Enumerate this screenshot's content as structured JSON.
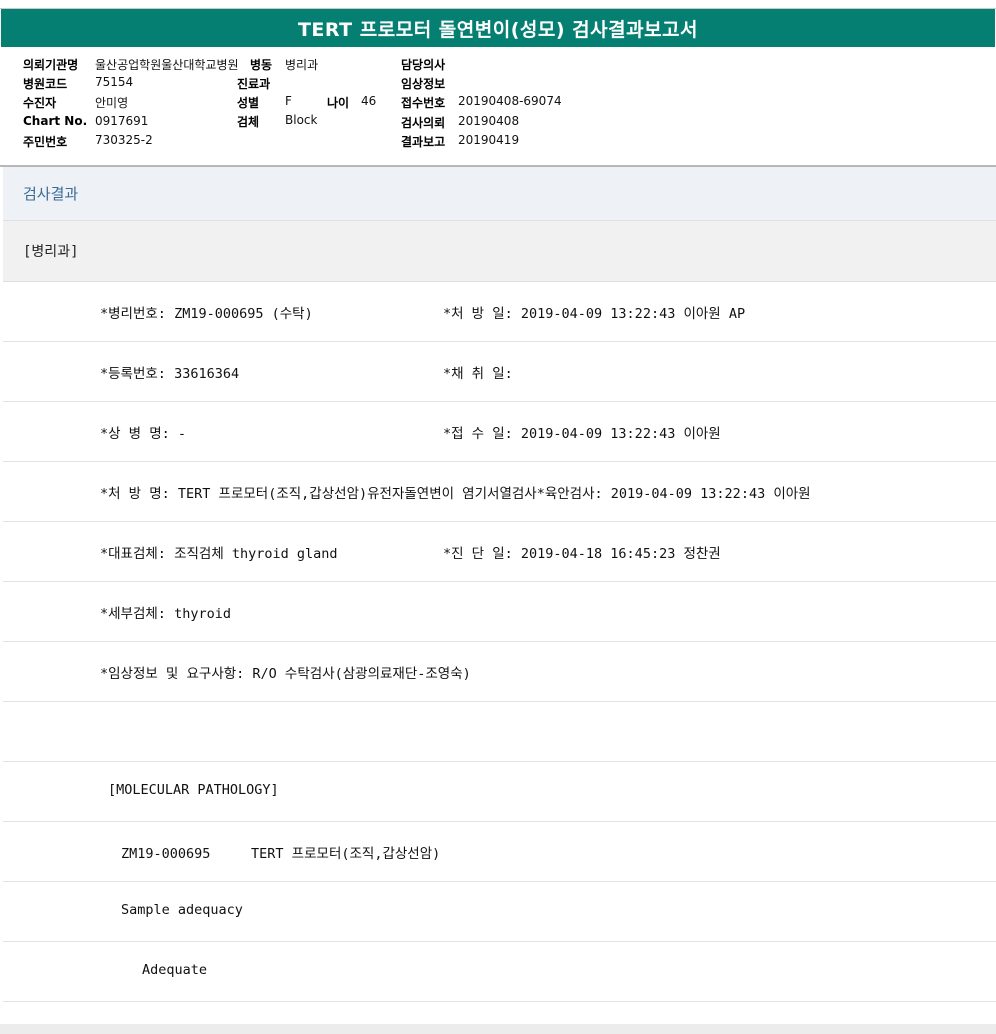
{
  "report": {
    "title": "TERT 프로모터 돌연변이(성모) 검사결과보고서"
  },
  "patient_info": {
    "institution_label": "의뢰기관명",
    "institution_value": "울산공업학원울산대학교병원",
    "ward_label": "병동",
    "ward_value": "병리과",
    "doctor_label": "담당의사",
    "doctor_value": "",
    "hospital_code_label": "병원코드",
    "hospital_code_value": "75154",
    "department_label": "진료과",
    "department_value": "",
    "clinical_info_label": "임상정보",
    "clinical_info_value": "",
    "recipient_label": "수진자",
    "recipient_value": "안미영",
    "sex_label": "성별",
    "sex_value": "F",
    "age_label": "나이",
    "age_value": "46",
    "accession_label": "접수번호",
    "accession_value": "20190408-69074",
    "chart_label": "Chart No.",
    "chart_value": "0917691",
    "specimen_label": "검체",
    "specimen_value": "Block",
    "requested_label": "검사의뢰",
    "requested_value": "20190408",
    "resident_label": "주민번호",
    "resident_value": "730325-2",
    "reported_label": "결과보고",
    "reported_value": "20190419"
  },
  "results": {
    "section_title": "검사결과",
    "department": "[병리과]",
    "rows": [
      {
        "left": "*병리번호: ZM19-000695 (수탁)",
        "right": "*처 방 일: 2019-04-09 13:22:43  이아원 AP"
      },
      {
        "left": "*등록번호: 33616364",
        "right": "*채 취 일:"
      },
      {
        "left": "*상 병 명: -",
        "right": "*접 수 일: 2019-04-09 13:22:43  이아원"
      },
      {
        "left": "*처 방 명: TERT 프로모터(조직,갑상선암)유전자돌연변이 염기서열검사*육안검사: 2019-04-09 13:22:43  이아원",
        "right": ""
      },
      {
        "left": "*대표검체: 조직검체 thyroid gland",
        "right": "*진 단 일: 2019-04-18 16:45:23  정찬권"
      },
      {
        "left": "*세부검체: thyroid",
        "right": ""
      },
      {
        "left": "*임상정보 및 요구사항: R/O 수탁검사(삼광의료재단-조영숙)",
        "right": ""
      },
      {
        "left": "",
        "right": ""
      },
      {
        "left": "[MOLECULAR PATHOLOGY]",
        "right": ""
      },
      {
        "left": "ZM19-000695     TERT 프로모터(조직,갑상선암)",
        "right": ""
      },
      {
        "left": "Sample adequacy",
        "right": ""
      },
      {
        "left": "Adequate",
        "right": ""
      }
    ]
  },
  "colors": {
    "title_bar": "#047f72",
    "section_text": "#3a6a96"
  }
}
